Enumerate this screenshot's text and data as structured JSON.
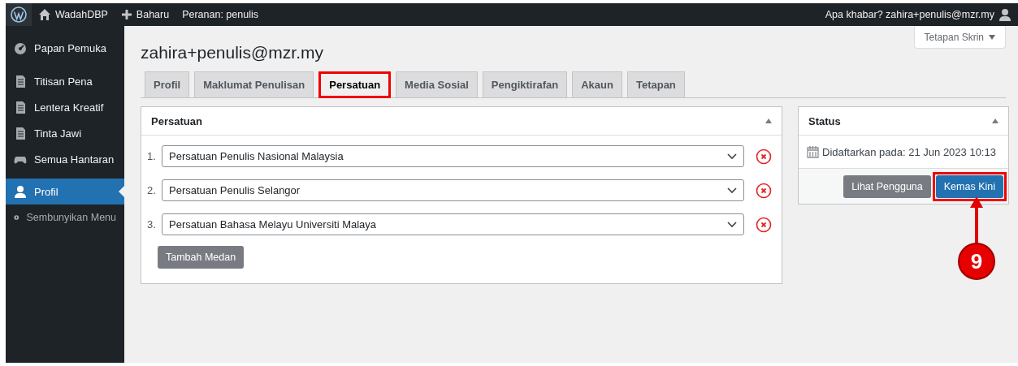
{
  "admin_bar": {
    "site": "WadahDBP",
    "new": "Baharu",
    "role": "Peranan: penulis",
    "greeting": "Apa khabar? zahira+penulis@mzr.my"
  },
  "sidebar": {
    "items": [
      {
        "label": "Papan Pemuka",
        "kind": "dashboard",
        "selected": false
      },
      {
        "label": "Titisan Pena",
        "kind": "document",
        "selected": false
      },
      {
        "label": "Lentera Kreatif",
        "kind": "document",
        "selected": false
      },
      {
        "label": "Tinta Jawi",
        "kind": "document",
        "selected": false
      },
      {
        "label": "Semua Hantaran",
        "kind": "gamepad",
        "selected": false
      },
      {
        "label": "Profil",
        "kind": "user",
        "selected": true
      }
    ],
    "collapse": "Sembunyikan Menu"
  },
  "screen_options": "Tetapan Skrin",
  "page_title": "zahira+penulis@mzr.my",
  "tabs": [
    {
      "label": "Profil",
      "selected": false,
      "highlighted": false
    },
    {
      "label": "Maklumat Penulisan",
      "selected": false,
      "highlighted": false
    },
    {
      "label": "Persatuan",
      "selected": true,
      "highlighted": true
    },
    {
      "label": "Media Sosial",
      "selected": false,
      "highlighted": false
    },
    {
      "label": "Pengiktirafan",
      "selected": false,
      "highlighted": false
    },
    {
      "label": "Akaun",
      "selected": false,
      "highlighted": false
    },
    {
      "label": "Tetapan",
      "selected": false,
      "highlighted": false
    }
  ],
  "persatuan_panel": {
    "title": "Persatuan",
    "fields": [
      {
        "number": "1.",
        "value": "Persatuan Penulis Nasional Malaysia"
      },
      {
        "number": "2.",
        "value": "Persatuan Penulis Selangor"
      },
      {
        "number": "3.",
        "value": "Persatuan Bahasa Melayu Universiti Malaya"
      }
    ],
    "add_button": "Tambah Medan"
  },
  "status_panel": {
    "title": "Status",
    "registered_label": "Didaftarkan pada:",
    "registered_date": "21 Jun 2023 10:13",
    "buttons": [
      {
        "label": "Lihat Pengguna",
        "kind": "secondary",
        "highlighted": false
      },
      {
        "label": "Kemas Kini",
        "kind": "primary",
        "highlighted": true
      }
    ]
  },
  "annotation": {
    "number": "9"
  }
}
